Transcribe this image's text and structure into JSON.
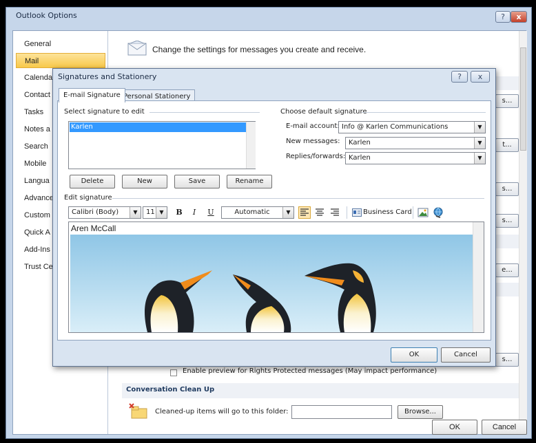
{
  "outer": {
    "title": "Outlook Options",
    "help_glyph": "?",
    "close_glyph": "x",
    "nav": [
      "General",
      "Mail",
      "Calenda",
      "Contact",
      "Tasks",
      "Notes a",
      "Search",
      "Mobile",
      "Langua",
      "Advance",
      "Custom",
      "Quick A",
      "Add-Ins",
      "Trust Ce"
    ],
    "nav_selected": "Mail",
    "header": "Change the settings for messages you create and receive.",
    "side_button_label": "...",
    "truncated_button_labels": [
      "s...",
      "t...",
      "s...",
      "s...",
      "e...",
      "s..."
    ],
    "rights_preview_text": "Enable preview for Rights Protected messages (May impact performance)",
    "section_conversation": "Conversation Clean Up",
    "cleaned_label": "Cleaned-up items will go to this folder:",
    "browse_label": "Browse...",
    "ok_label": "OK",
    "cancel_label": "Cancel"
  },
  "dialog": {
    "title": "Signatures and Stationery",
    "help_glyph": "?",
    "close_glyph": "x",
    "tabs": [
      "E-mail Signature",
      "Personal Stationery"
    ],
    "select_label": "Select signature to edit",
    "signatures": [
      "Karlen"
    ],
    "buttons": {
      "delete": "Delete",
      "new": "New",
      "save": "Save",
      "rename": "Rename"
    },
    "default_group": "Choose default signature",
    "email_account_label": "E-mail account:",
    "email_account_value": "Info @ Karlen Communications",
    "new_messages_label": "New messages:",
    "new_messages_value": "Karlen",
    "replies_label": "Replies/forwards:",
    "replies_value": "Karlen",
    "edit_label": "Edit signature",
    "font_value": "Calibri (Body)",
    "size_value": "11",
    "bold_glyph": "B",
    "italic_glyph": "I",
    "underline_glyph": "U",
    "color_value": "Automatic",
    "business_card_label": "Business Card",
    "signature_text": "Aren McCall",
    "ok_label": "OK",
    "cancel_label": "Cancel"
  }
}
